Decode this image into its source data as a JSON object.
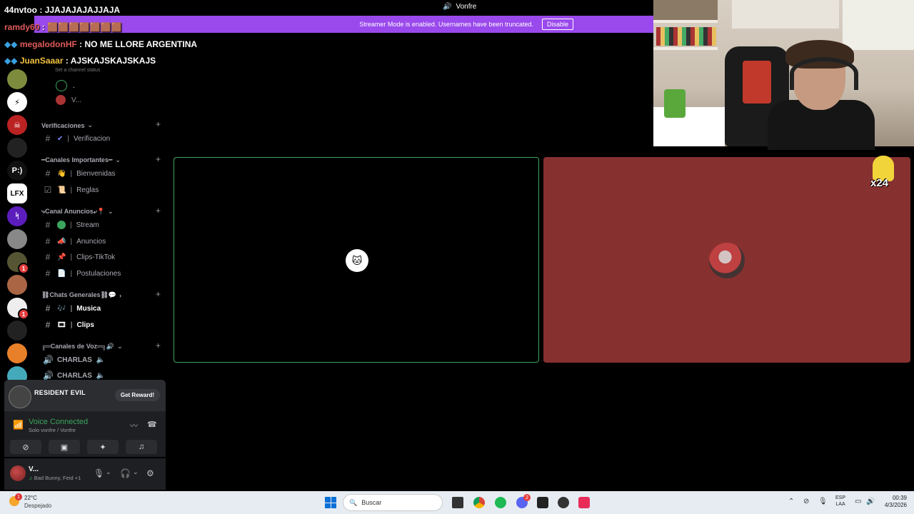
{
  "window": {
    "title": "Vonfre"
  },
  "streamer_banner": {
    "message": "Streamer Mode is enabled. Usernames have been truncated.",
    "disable_label": "Disable"
  },
  "chat_overlay": [
    {
      "name": "44nvtoo",
      "message": ": JJAJAJAJAJJAJA"
    },
    {
      "name": "ramdy60",
      "message": ":"
    },
    {
      "name": "megalodonHF",
      "message": ": NO ME LLORE ARGENTINA"
    },
    {
      "name": "JuanSaaar",
      "message": ": AJSKAJSKAJSKAJS"
    }
  ],
  "channel_status_placeholder": "Set a channel status",
  "voice_members": [
    ".",
    "V..."
  ],
  "categories": {
    "verificaciones": "Verificaciones",
    "importantes": "━Canales Importantes━",
    "anuncios": "⤷Canal Anuncios⤶📍",
    "generales": "⛓Chats Generales⛓💬",
    "voz": "╔═Canales de Voz═╗🔊"
  },
  "channels": {
    "verificacion": "Verificacion",
    "bienvenidas": "Bienvenidas",
    "reglas": "Reglas",
    "stream": "Stream",
    "anuncios": "Anuncios",
    "clips_tiktok": "Clips-TikTok",
    "postulaciones": "Postulaciones",
    "musica": "Musica",
    "clips": "Clips",
    "charlas1": "CHARLAS",
    "charlas2": "CHARLAS"
  },
  "server_rail": {
    "text_server": "P:)",
    "lfx_server": "LFX",
    "badges": [
      "1",
      "1"
    ]
  },
  "reward": {
    "title": "RESIDENT EVIL",
    "button": "Get Reward!"
  },
  "voice": {
    "status": "Voice Connected",
    "location": "Solo vonfre / Vonfre"
  },
  "user": {
    "name": "V...",
    "activity": "Bad Bunny, Feid +1"
  },
  "overlay_minion": {
    "count": "x24"
  },
  "taskbar": {
    "weather_temp": "22°C",
    "weather_desc": "Despejado",
    "notification_count": "1",
    "search_placeholder": "Buscar",
    "discord_badge": "2",
    "lang_top": "ESP",
    "lang_bottom": "LAA",
    "time": "00:39",
    "date": "4/3/2026"
  },
  "colors": {
    "accent_green": "#3ba55d",
    "streamer_purple": "#9a49ec",
    "tile_red": "#873030"
  }
}
